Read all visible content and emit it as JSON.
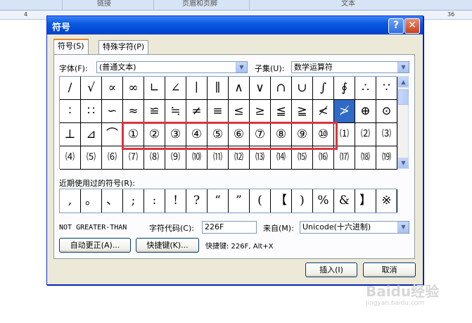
{
  "ribbon": {
    "tabs": [
      "链接",
      "页眉和页脚",
      "文本"
    ]
  },
  "ruler": {
    "left_mark": "4",
    "right_mark": "36"
  },
  "dialog": {
    "title": "符号",
    "help_glyph": "?",
    "close_glyph": "✕",
    "tabs": [
      "符号(S)",
      "特殊字符(P)"
    ],
    "font_label": "字体(F):",
    "font_value": "(普通文本)",
    "subset_label": "子集(U):",
    "subset_value": "数学运算符",
    "symbols": [
      [
        "/",
        "√",
        "∝",
        "∞",
        "∟",
        "∠",
        "∣",
        "∥",
        "∧",
        "∨",
        "∩",
        "∪",
        "∫",
        "∮",
        "∴",
        "∵"
      ],
      [
        "∶",
        "∷",
        "∽",
        "≈",
        "≌",
        "≒",
        "≠",
        "≡",
        "≤",
        "≥",
        "≦",
        "≧",
        "≮",
        "≯",
        "⊕",
        "⊙"
      ],
      [
        "⊥",
        "⊿",
        "⌒",
        "①",
        "②",
        "③",
        "④",
        "⑤",
        "⑥",
        "⑦",
        "⑧",
        "⑨",
        "⑩",
        "⑴",
        "⑵",
        "⑶"
      ],
      [
        "⑷",
        "⑸",
        "⑹",
        "⑺",
        "⑻",
        "⑼",
        "⑽",
        "⑾",
        "⑿",
        "⒀",
        "⒁",
        "⒂",
        "⒃",
        "⒄",
        "⒅",
        "⒆"
      ]
    ],
    "selected": {
      "row": 1,
      "col": 13
    },
    "recent_label": "近期使用过的符号(R):",
    "recent": [
      ",",
      "。",
      "、",
      ";",
      ":",
      "!",
      "?",
      "“",
      "”",
      "(",
      "【",
      ")",
      "%",
      "&",
      "】",
      "※"
    ],
    "char_name": "NOT GREATER-THAN",
    "code_label": "字符代码(C):",
    "code_value": "226F",
    "from_label": "来自(M):",
    "from_value": "Unicode(十六进制)",
    "autocorrect_button": "自动更正(A)...",
    "shortcut_button": "快捷键(K)...",
    "shortcut_text": "快捷键: 226F, Alt+X",
    "insert_button": "插入(I)",
    "cancel_button": "取消"
  },
  "watermark": {
    "brand": "Baidu经验",
    "sub": "jingyan.baidu.com"
  }
}
